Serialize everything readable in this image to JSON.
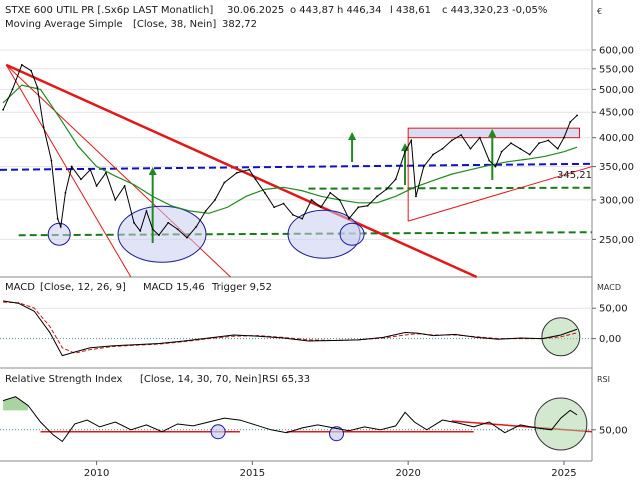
{
  "colors": {
    "price": "#000000",
    "sma": "#1f8a1f",
    "support_dashed": "#1a7a1a",
    "resistance_blue": "#1010c8",
    "trendline": "#e01818",
    "zone_fill": "#c8cdf0",
    "zone_stroke": "#1a1a9a",
    "macd_line": "#000000",
    "trigger_line": "#c81818",
    "green_arrow": "#1f8a1f",
    "rsi_fill": "#a8d4a0",
    "up_value": "#1f8a1f",
    "down_value": "#d01818"
  },
  "header": {
    "instrument": "STXE 600 UTIL PR [.Sx6p LAST Monatlich]",
    "date": "30.06.2025",
    "open": "o 443,87",
    "high": "h 446,34",
    "low": "l 438,61",
    "close": "c 443,32",
    "change": "-0,23",
    "change_pct": "-0,05%",
    "sma_label": "Moving Average Simple",
    "sma_params": "[Close, 38, Nein]",
    "sma_value": "382,72",
    "currency": "€"
  },
  "macd_panel": {
    "label": "MACD",
    "params": "[Close, 12, 26, 9]",
    "macd_text": "MACD 15,46",
    "trigger_text": "Trigger 9,52",
    "unit": "MACD"
  },
  "rsi_panel": {
    "label": "Relative Strength Index",
    "params": "[Close, 14, 30, 70, Nein]",
    "rsi_text": "RSI 65,33",
    "unit": "RSI"
  },
  "chart_data": {
    "type": "line",
    "price_axis": {
      "ticks": [
        250,
        300,
        350,
        400,
        450,
        500,
        550,
        600
      ],
      "tick_labels": [
        "250,00",
        "300,00",
        "350,00",
        "400,00",
        "450,00",
        "500,00",
        "550,00",
        "600,00"
      ],
      "scale": "log",
      "ylim": [
        215,
        640
      ]
    },
    "x_axis": {
      "ticks": [
        2010,
        2015,
        2020,
        2025
      ],
      "tick_labels": [
        "2010",
        "2015",
        "2020",
        "2025"
      ],
      "xlim": [
        2006.9,
        2025.9
      ]
    },
    "price_series": {
      "name": "STXE 600 UTIL PR",
      "x": [
        2007.0,
        2007.3,
        2007.6,
        2007.9,
        2008.1,
        2008.3,
        2008.55,
        2008.75,
        2008.85,
        2009.0,
        2009.2,
        2009.5,
        2009.8,
        2010.0,
        2010.3,
        2010.6,
        2010.9,
        2011.2,
        2011.4,
        2011.6,
        2011.8,
        2012.0,
        2012.3,
        2012.6,
        2012.9,
        2013.2,
        2013.5,
        2013.8,
        2014.1,
        2014.5,
        2014.9,
        2015.1,
        2015.4,
        2015.7,
        2016.0,
        2016.3,
        2016.6,
        2016.9,
        2017.2,
        2017.5,
        2017.8,
        2018.1,
        2018.4,
        2018.7,
        2019.0,
        2019.3,
        2019.6,
        2019.9,
        2020.1,
        2020.25,
        2020.5,
        2020.8,
        2021.1,
        2021.4,
        2021.7,
        2022.0,
        2022.3,
        2022.6,
        2022.8,
        2023.0,
        2023.3,
        2023.6,
        2023.9,
        2024.2,
        2024.5,
        2024.8,
        2025.0,
        2025.2,
        2025.42
      ],
      "values": [
        455,
        500,
        560,
        545,
        505,
        420,
        360,
        275,
        265,
        310,
        350,
        330,
        345,
        320,
        340,
        300,
        320,
        270,
        260,
        285,
        262,
        255,
        270,
        262,
        252,
        265,
        285,
        300,
        325,
        340,
        345,
        330,
        310,
        290,
        295,
        280,
        275,
        300,
        290,
        310,
        300,
        275,
        290,
        292,
        305,
        315,
        330,
        375,
        395,
        305,
        350,
        370,
        380,
        395,
        405,
        380,
        400,
        360,
        350,
        375,
        390,
        380,
        370,
        390,
        395,
        380,
        400,
        430,
        443.32
      ]
    },
    "sma_series": {
      "name": "Moving Average Simple",
      "x": [
        2007.0,
        2007.6,
        2008.2,
        2008.8,
        2009.4,
        2010.0,
        2010.6,
        2011.2,
        2011.8,
        2012.4,
        2013.0,
        2013.6,
        2014.2,
        2014.8,
        2015.4,
        2016.0,
        2016.6,
        2017.2,
        2017.8,
        2018.4,
        2019.0,
        2019.6,
        2020.2,
        2020.8,
        2021.4,
        2022.0,
        2022.6,
        2023.2,
        2023.8,
        2024.4,
        2025.0,
        2025.42
      ],
      "values": [
        470,
        510,
        500,
        440,
        385,
        350,
        335,
        322,
        305,
        292,
        285,
        282,
        290,
        305,
        315,
        318,
        313,
        305,
        300,
        296,
        296,
        305,
        318,
        328,
        338,
        345,
        352,
        358,
        362,
        367,
        375,
        382.72
      ]
    },
    "resistance_level": 348,
    "support_levels": [
      256,
      316
    ],
    "annotation_value": "345,21",
    "rectangle_zone": {
      "x": [
        2020.0,
        2025.5
      ],
      "y": [
        400,
        418
      ]
    },
    "macd": {
      "ticks": [
        0,
        50
      ],
      "tick_labels": [
        "0,00",
        "50,00"
      ],
      "ylim": [
        -45,
        75
      ],
      "x": [
        2007.0,
        2007.5,
        2008.0,
        2008.5,
        2008.9,
        2009.3,
        2009.8,
        2010.5,
        2011.2,
        2012.0,
        2012.8,
        2013.6,
        2014.4,
        2015.2,
        2016.0,
        2016.8,
        2017.6,
        2018.4,
        2019.2,
        2019.9,
        2020.3,
        2020.8,
        2021.5,
        2022.2,
        2022.9,
        2023.6,
        2024.3,
        2024.9,
        2025.42
      ],
      "macd_values": [
        62,
        58,
        45,
        10,
        -28,
        -22,
        -15,
        -12,
        -10,
        -8,
        -4,
        1,
        6,
        4,
        1,
        -4,
        -3,
        -2,
        2,
        10,
        9,
        5,
        7,
        2,
        -1,
        1,
        0,
        6,
        15.46
      ],
      "trigger_values": [
        60,
        59,
        50,
        20,
        -15,
        -24,
        -18,
        -13,
        -11,
        -9,
        -5,
        0,
        4,
        5,
        2,
        -2,
        -3,
        -2,
        1,
        6,
        8,
        6,
        6,
        3,
        0,
        0,
        0,
        3,
        9.52
      ]
    },
    "rsi": {
      "ticks": [
        50
      ],
      "tick_labels": [
        "50,00"
      ],
      "ylim": [
        20,
        95
      ],
      "x": [
        2007.0,
        2007.4,
        2007.8,
        2008.2,
        2008.6,
        2008.9,
        2009.3,
        2009.7,
        2010.1,
        2010.6,
        2011.1,
        2011.6,
        2012.1,
        2012.6,
        2013.1,
        2013.6,
        2014.1,
        2014.6,
        2015.1,
        2015.6,
        2016.1,
        2016.6,
        2017.1,
        2017.6,
        2018.1,
        2018.6,
        2019.1,
        2019.6,
        2019.9,
        2020.2,
        2020.6,
        2021.1,
        2021.6,
        2022.1,
        2022.6,
        2023.1,
        2023.6,
        2024.1,
        2024.6,
        2024.9,
        2025.2,
        2025.42
      ],
      "values": [
        80,
        84,
        75,
        58,
        45,
        38,
        56,
        60,
        53,
        58,
        50,
        55,
        48,
        56,
        54,
        58,
        62,
        60,
        55,
        50,
        47,
        52,
        55,
        52,
        49,
        53,
        50,
        54,
        68,
        58,
        50,
        60,
        57,
        53,
        58,
        47,
        55,
        52,
        50,
        62,
        70,
        65.33
      ]
    }
  }
}
